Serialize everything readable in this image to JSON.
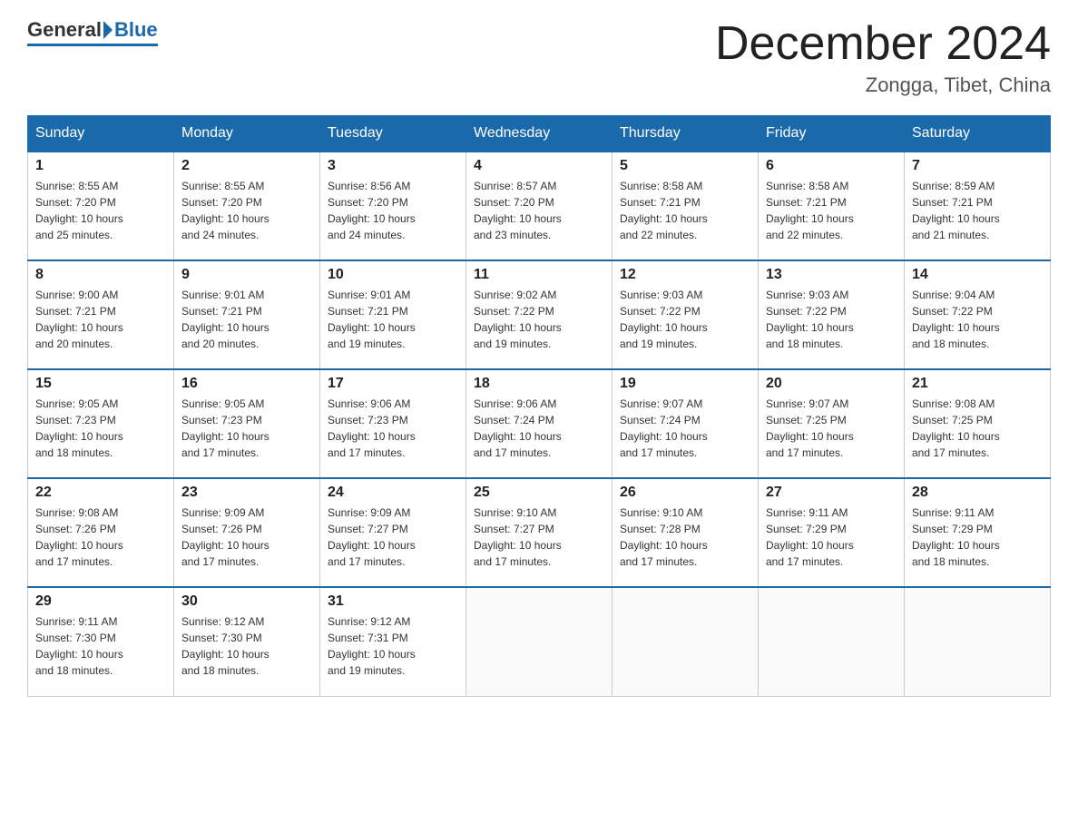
{
  "header": {
    "logo_general": "General",
    "logo_blue": "Blue",
    "title": "December 2024",
    "subtitle": "Zongga, Tibet, China"
  },
  "days_of_week": [
    "Sunday",
    "Monday",
    "Tuesday",
    "Wednesday",
    "Thursday",
    "Friday",
    "Saturday"
  ],
  "weeks": [
    [
      {
        "day": "1",
        "sunrise": "8:55 AM",
        "sunset": "7:20 PM",
        "daylight": "10 hours and 25 minutes."
      },
      {
        "day": "2",
        "sunrise": "8:55 AM",
        "sunset": "7:20 PM",
        "daylight": "10 hours and 24 minutes."
      },
      {
        "day": "3",
        "sunrise": "8:56 AM",
        "sunset": "7:20 PM",
        "daylight": "10 hours and 24 minutes."
      },
      {
        "day": "4",
        "sunrise": "8:57 AM",
        "sunset": "7:20 PM",
        "daylight": "10 hours and 23 minutes."
      },
      {
        "day": "5",
        "sunrise": "8:58 AM",
        "sunset": "7:21 PM",
        "daylight": "10 hours and 22 minutes."
      },
      {
        "day": "6",
        "sunrise": "8:58 AM",
        "sunset": "7:21 PM",
        "daylight": "10 hours and 22 minutes."
      },
      {
        "day": "7",
        "sunrise": "8:59 AM",
        "sunset": "7:21 PM",
        "daylight": "10 hours and 21 minutes."
      }
    ],
    [
      {
        "day": "8",
        "sunrise": "9:00 AM",
        "sunset": "7:21 PM",
        "daylight": "10 hours and 20 minutes."
      },
      {
        "day": "9",
        "sunrise": "9:01 AM",
        "sunset": "7:21 PM",
        "daylight": "10 hours and 20 minutes."
      },
      {
        "day": "10",
        "sunrise": "9:01 AM",
        "sunset": "7:21 PM",
        "daylight": "10 hours and 19 minutes."
      },
      {
        "day": "11",
        "sunrise": "9:02 AM",
        "sunset": "7:22 PM",
        "daylight": "10 hours and 19 minutes."
      },
      {
        "day": "12",
        "sunrise": "9:03 AM",
        "sunset": "7:22 PM",
        "daylight": "10 hours and 19 minutes."
      },
      {
        "day": "13",
        "sunrise": "9:03 AM",
        "sunset": "7:22 PM",
        "daylight": "10 hours and 18 minutes."
      },
      {
        "day": "14",
        "sunrise": "9:04 AM",
        "sunset": "7:22 PM",
        "daylight": "10 hours and 18 minutes."
      }
    ],
    [
      {
        "day": "15",
        "sunrise": "9:05 AM",
        "sunset": "7:23 PM",
        "daylight": "10 hours and 18 minutes."
      },
      {
        "day": "16",
        "sunrise": "9:05 AM",
        "sunset": "7:23 PM",
        "daylight": "10 hours and 17 minutes."
      },
      {
        "day": "17",
        "sunrise": "9:06 AM",
        "sunset": "7:23 PM",
        "daylight": "10 hours and 17 minutes."
      },
      {
        "day": "18",
        "sunrise": "9:06 AM",
        "sunset": "7:24 PM",
        "daylight": "10 hours and 17 minutes."
      },
      {
        "day": "19",
        "sunrise": "9:07 AM",
        "sunset": "7:24 PM",
        "daylight": "10 hours and 17 minutes."
      },
      {
        "day": "20",
        "sunrise": "9:07 AM",
        "sunset": "7:25 PM",
        "daylight": "10 hours and 17 minutes."
      },
      {
        "day": "21",
        "sunrise": "9:08 AM",
        "sunset": "7:25 PM",
        "daylight": "10 hours and 17 minutes."
      }
    ],
    [
      {
        "day": "22",
        "sunrise": "9:08 AM",
        "sunset": "7:26 PM",
        "daylight": "10 hours and 17 minutes."
      },
      {
        "day": "23",
        "sunrise": "9:09 AM",
        "sunset": "7:26 PM",
        "daylight": "10 hours and 17 minutes."
      },
      {
        "day": "24",
        "sunrise": "9:09 AM",
        "sunset": "7:27 PM",
        "daylight": "10 hours and 17 minutes."
      },
      {
        "day": "25",
        "sunrise": "9:10 AM",
        "sunset": "7:27 PM",
        "daylight": "10 hours and 17 minutes."
      },
      {
        "day": "26",
        "sunrise": "9:10 AM",
        "sunset": "7:28 PM",
        "daylight": "10 hours and 17 minutes."
      },
      {
        "day": "27",
        "sunrise": "9:11 AM",
        "sunset": "7:29 PM",
        "daylight": "10 hours and 17 minutes."
      },
      {
        "day": "28",
        "sunrise": "9:11 AM",
        "sunset": "7:29 PM",
        "daylight": "10 hours and 18 minutes."
      }
    ],
    [
      {
        "day": "29",
        "sunrise": "9:11 AM",
        "sunset": "7:30 PM",
        "daylight": "10 hours and 18 minutes."
      },
      {
        "day": "30",
        "sunrise": "9:12 AM",
        "sunset": "7:30 PM",
        "daylight": "10 hours and 18 minutes."
      },
      {
        "day": "31",
        "sunrise": "9:12 AM",
        "sunset": "7:31 PM",
        "daylight": "10 hours and 19 minutes."
      },
      null,
      null,
      null,
      null
    ]
  ],
  "labels": {
    "sunrise": "Sunrise:",
    "sunset": "Sunset:",
    "daylight": "Daylight:"
  }
}
